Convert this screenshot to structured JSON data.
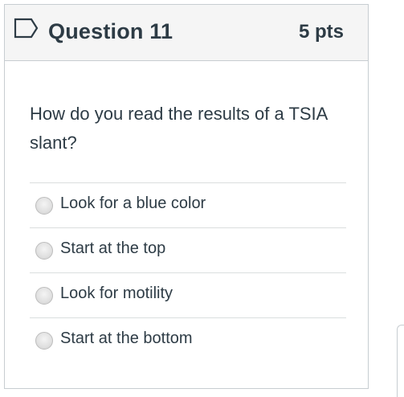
{
  "question": {
    "title": "Question 11",
    "points": "5 pts",
    "text": "How do you read the results of a TSIA slant?",
    "flag_icon": "flag-outline-icon",
    "answers": [
      {
        "label": "Look for a blue color",
        "selected": false
      },
      {
        "label": "Start at the top",
        "selected": false
      },
      {
        "label": "Look for motility",
        "selected": false
      },
      {
        "label": "Start at the bottom",
        "selected": false
      }
    ]
  },
  "colors": {
    "text": "#2d3b45",
    "header_bg": "#f5f5f5",
    "border": "#c7cdd1"
  }
}
